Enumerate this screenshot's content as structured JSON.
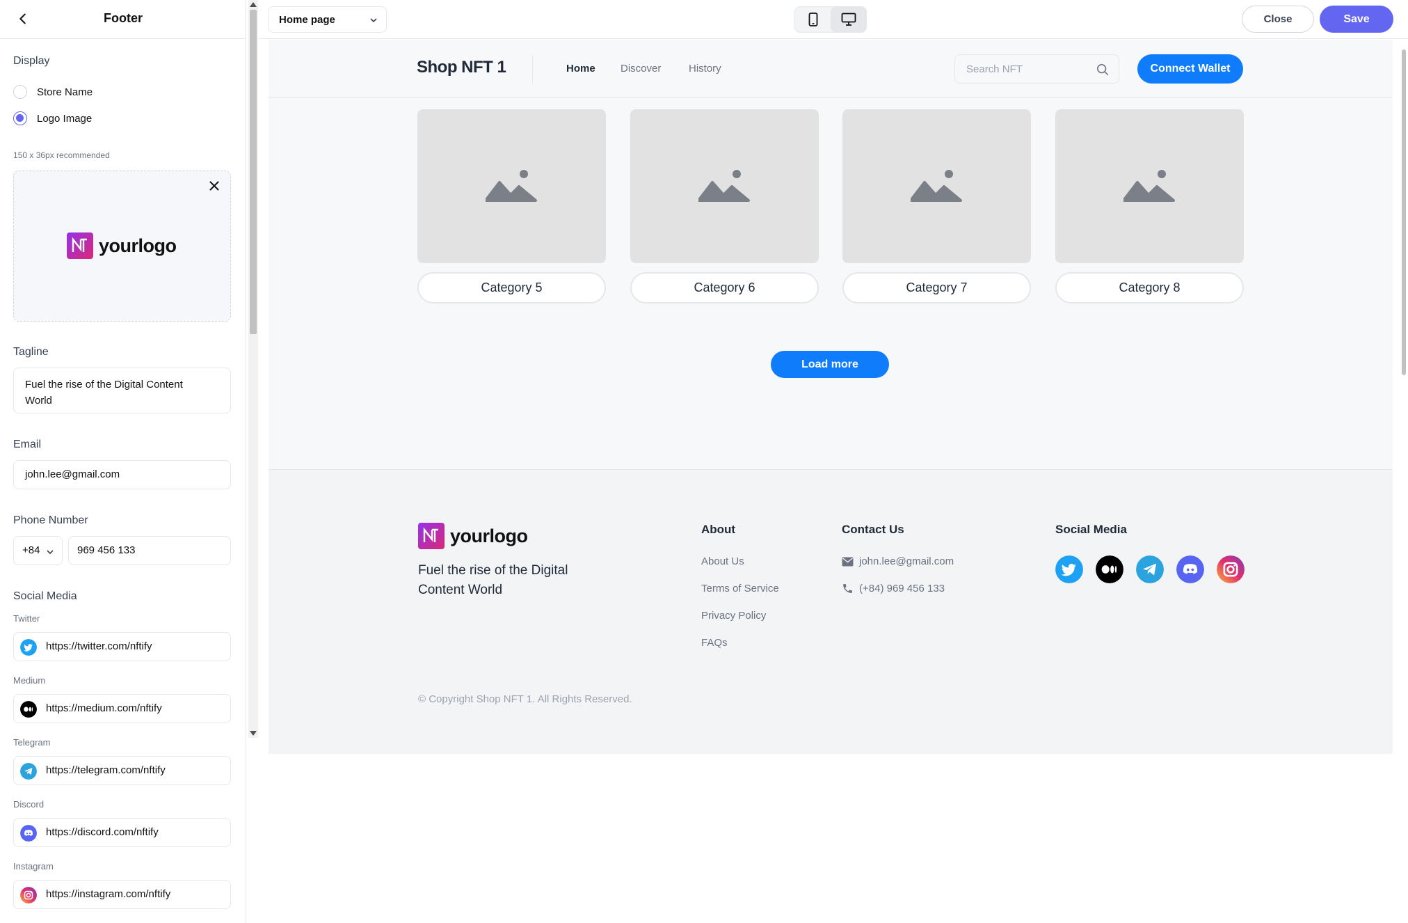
{
  "panel": {
    "title": "Footer",
    "display_label": "Display",
    "options": [
      "Store Name",
      "Logo Image"
    ],
    "selected_option": "Logo Image",
    "logo_hint": "150 x 36px recommended",
    "logo_text": "yourlogo",
    "tagline_label": "Tagline",
    "tagline_line1": "Fuel the rise of the Digital Content",
    "tagline_line2": "World",
    "email_label": "Email",
    "email_value": "john.lee@gmail.com",
    "phone_label": "Phone Number",
    "phone_code": "+84",
    "phone_value": "969 456 133",
    "social_label": "Social Media",
    "socials": [
      {
        "label": "Twitter",
        "url": "https://twitter.com/nftify",
        "icon": "twitter-icon",
        "color": "#1da1f2"
      },
      {
        "label": "Medium",
        "url": "https://medium.com/nftify",
        "icon": "medium-icon",
        "color": "#000000"
      },
      {
        "label": "Telegram",
        "url": "https://telegram.com/nftify",
        "icon": "telegram-icon",
        "color": "#2aa3df"
      },
      {
        "label": "Discord",
        "url": "https://discord.com/nftify",
        "icon": "discord-icon",
        "color": "#5865f2"
      },
      {
        "label": "Instagram",
        "url": "https://instagram.com/nftify",
        "icon": "instagram-icon",
        "color": "#e1306c"
      }
    ]
  },
  "toolbar": {
    "page_select": "Home page",
    "close_label": "Close",
    "save_label": "Save",
    "accent": "#6366f1"
  },
  "site": {
    "shop_name": "Shop NFT 1",
    "nav": [
      "Home",
      "Discover",
      "History"
    ],
    "search_placeholder": "Search NFT",
    "connect_label": "Connect Wallet",
    "categories": [
      "Category 5",
      "Category 6",
      "Category 7",
      "Category 8"
    ],
    "load_more": "Load more",
    "brand_color": "#0f7cfb",
    "footer": {
      "logo_text": "yourlogo",
      "tagline": "Fuel the rise of the Digital Content World",
      "about_title": "About",
      "about_links": [
        "About Us",
        "Terms of Service",
        "Privacy Policy",
        "FAQs"
      ],
      "contact_title": "Contact Us",
      "contact_email": "john.lee@gmail.com",
      "contact_phone": "(+84) 969 456 133",
      "social_title": "Social Media",
      "copyright": "© Copyright Shop NFT 1. All Rights Reserved."
    }
  }
}
